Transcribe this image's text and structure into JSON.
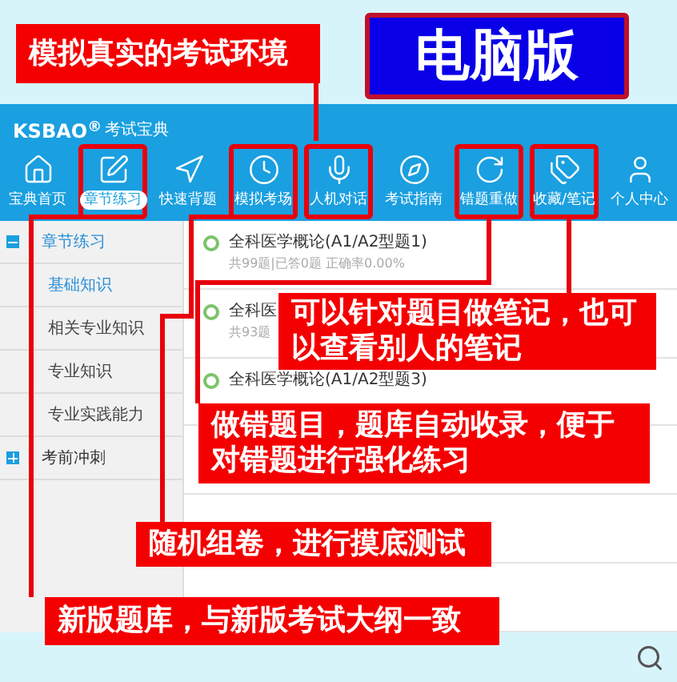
{
  "badge": {
    "text": "电脑版"
  },
  "app": {
    "logo": "KSBAO$^{®}$",
    "logo_subtitle": "考试宝典",
    "nav": [
      {
        "label": "宝典首页",
        "selected": false,
        "highlighted": false
      },
      {
        "label": "章节练习",
        "selected": true,
        "highlighted": true
      },
      {
        "label": "快速背题",
        "selected": false,
        "highlighted": false
      },
      {
        "label": "模拟考场",
        "selected": false,
        "highlighted": true
      },
      {
        "label": "人机对话",
        "selected": false,
        "highlighted": true
      },
      {
        "label": "考试指南",
        "selected": false,
        "highlighted": false
      },
      {
        "label": "错题重做",
        "selected": false,
        "highlighted": true
      },
      {
        "label": "收藏/笔记",
        "selected": false,
        "highlighted": true
      },
      {
        "label": "个人中心",
        "selected": false,
        "highlighted": false
      }
    ]
  },
  "sidebar": {
    "groups": [
      {
        "label": "章节练习",
        "expanded": true,
        "children": [
          {
            "label": "基础知识",
            "selected": true
          },
          {
            "label": "相关专业知识",
            "selected": false
          },
          {
            "label": "专业知识",
            "selected": false
          },
          {
            "label": "专业实践能力",
            "selected": false
          }
        ]
      },
      {
        "label": "考前冲刺",
        "expanded": false
      }
    ]
  },
  "list": [
    {
      "title": "全科医学概论(A1/A2型题1)",
      "subtitle": "共99题|已答0题  正确率0.00%"
    },
    {
      "title": "全科医",
      "subtitle": "共93题"
    },
    {
      "title": "全科医学概论(A1/A2型题3)"
    }
  ],
  "callouts": [
    {
      "text": "模拟真实的考试环境"
    },
    {
      "text": "可以针对题目做笔记，也可以查看别人的笔记"
    },
    {
      "text": "做错题目，题库自动收录，便于对错题进行强化练习"
    },
    {
      "text": "随机组卷，进行摸底测试"
    },
    {
      "text": "新版题库，与新版考试大纲一致"
    }
  ]
}
